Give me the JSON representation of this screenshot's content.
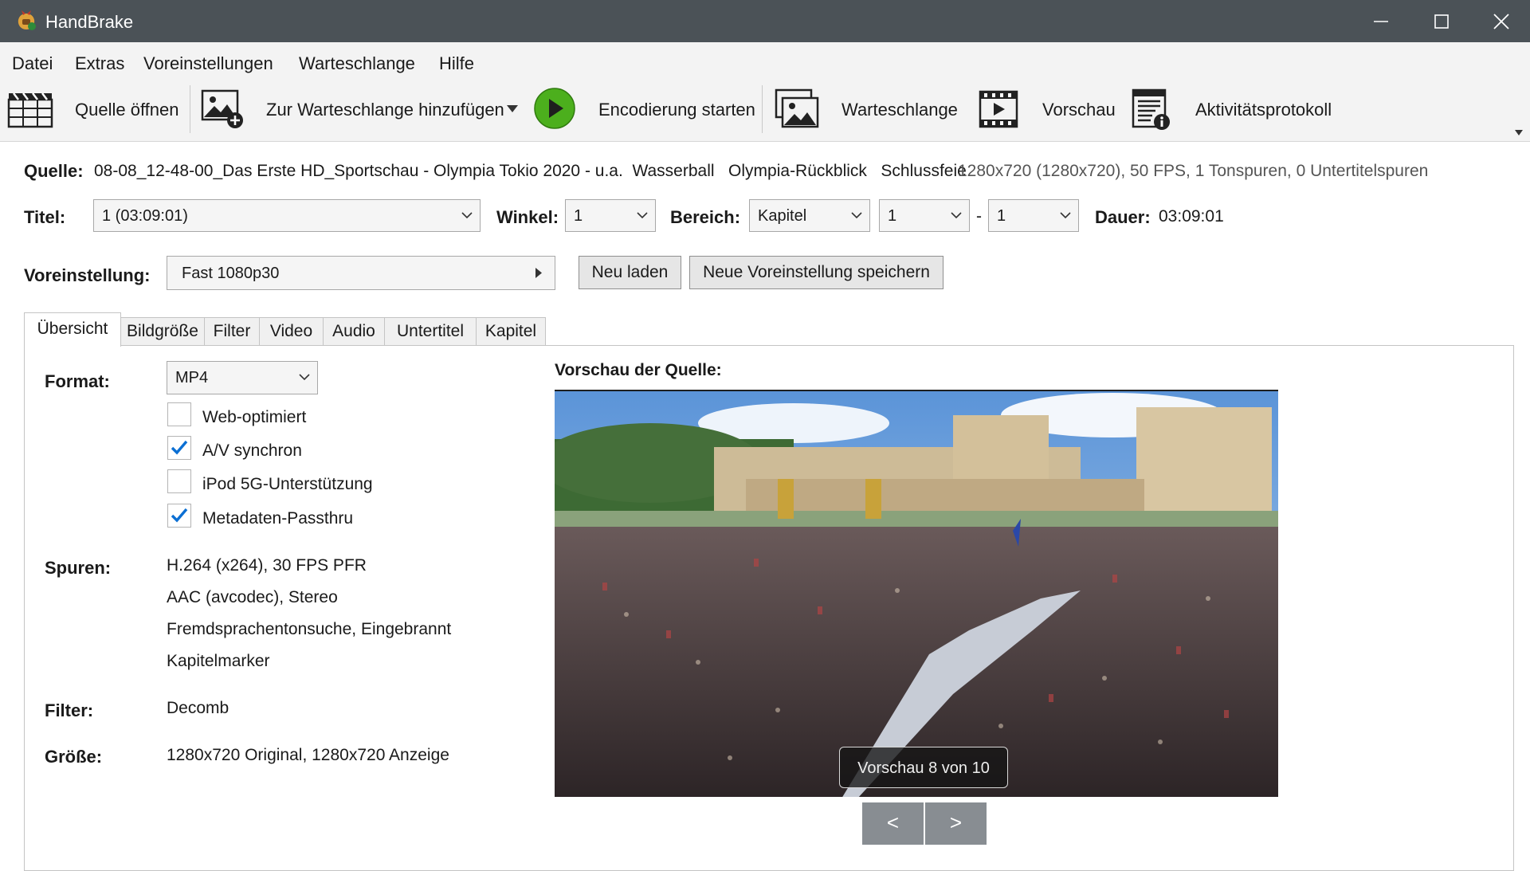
{
  "window": {
    "title": "HandBrake"
  },
  "menu": [
    "Datei",
    "Extras",
    "Voreinstellungen",
    "Warteschlange",
    "Hilfe"
  ],
  "toolbar": {
    "open_source": "Quelle öffnen",
    "add_to_queue": "Zur Warteschlange hinzufügen",
    "start_encode": "Encodierung starten",
    "queue": "Warteschlange",
    "preview": "Vorschau",
    "activity_log": "Aktivitätsprotokoll"
  },
  "source": {
    "label": "Quelle:",
    "name": "08-08_12-48-00_Das Erste HD_Sportschau - Olympia Tokio 2020 - u.a.  Wasserball   Olympia-Rückblick   Schlussfeie",
    "info": "1280x720 (1280x720), 50 FPS, 1 Tonspuren, 0 Untertitelspuren"
  },
  "title_row": {
    "title_label": "Titel:",
    "title_value": "1  (03:09:01)",
    "angle_label": "Winkel:",
    "angle_value": "1",
    "range_label": "Bereich:",
    "range_type": "Kapitel",
    "range_start": "1",
    "range_dash": "-",
    "range_end": "1",
    "duration_label": "Dauer:",
    "duration_value": "03:09:01"
  },
  "preset": {
    "label": "Voreinstellung:",
    "value": "Fast 1080p30",
    "reload": "Neu laden",
    "save_new": "Neue Voreinstellung speichern"
  },
  "tabs": [
    "Übersicht",
    "Bildgröße",
    "Filter",
    "Video",
    "Audio",
    "Untertitel",
    "Kapitel"
  ],
  "summary": {
    "format_label": "Format:",
    "format_value": "MP4",
    "checkboxes": [
      {
        "label": "Web-optimiert",
        "checked": false
      },
      {
        "label": "A/V synchron",
        "checked": true
      },
      {
        "label": "iPod 5G-Unterstützung",
        "checked": false
      },
      {
        "label": "Metadaten-Passthru",
        "checked": true
      }
    ],
    "tracks_label": "Spuren:",
    "tracks": [
      "H.264 (x264), 30 FPS PFR",
      "AAC (avcodec), Stereo",
      "Fremdsprachentonsuche, Eingebrannt",
      "Kapitelmarker"
    ],
    "filter_label": "Filter:",
    "filter_value": "Decomb",
    "size_label": "Größe:",
    "size_value": "1280x720 Original, 1280x720 Anzeige",
    "preview_heading": "Vorschau der Quelle:",
    "preview_overlay": "Vorschau 8 von 10",
    "prev_button": "<",
    "next_button": ">"
  },
  "colors": {
    "titlebar": "#4b5257",
    "accent": "#0b6fd3",
    "play_green": "#4caf1d"
  }
}
